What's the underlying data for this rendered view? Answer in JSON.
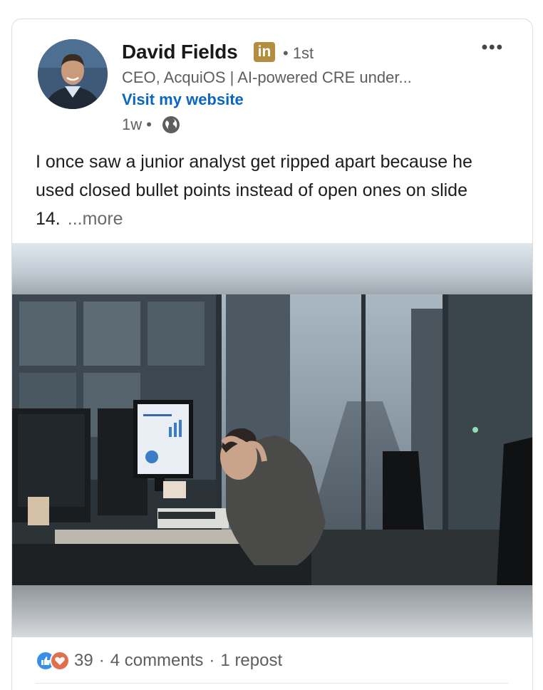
{
  "post": {
    "author": {
      "name": "David Fields",
      "badge": "in",
      "degree": "• 1st",
      "headline": "CEO, AcquiOS | AI-powered CRE under...",
      "website_label": "Visit my website",
      "time": "1w •"
    },
    "menu_label": "•••",
    "text": "I once saw a junior analyst get ripped apart because he used closed bullet points instead of open ones on slide 14.",
    "see_more": "...more",
    "image": {
      "description_icon": "office-photo"
    },
    "social": {
      "reaction_count": "39",
      "comments": "4 comments",
      "reposts": "1 repost",
      "separator": "·"
    }
  },
  "colors": {
    "link": "#0a66c2",
    "badge": "#b58d3e",
    "like": "#378fe9",
    "love": "#df704d"
  }
}
